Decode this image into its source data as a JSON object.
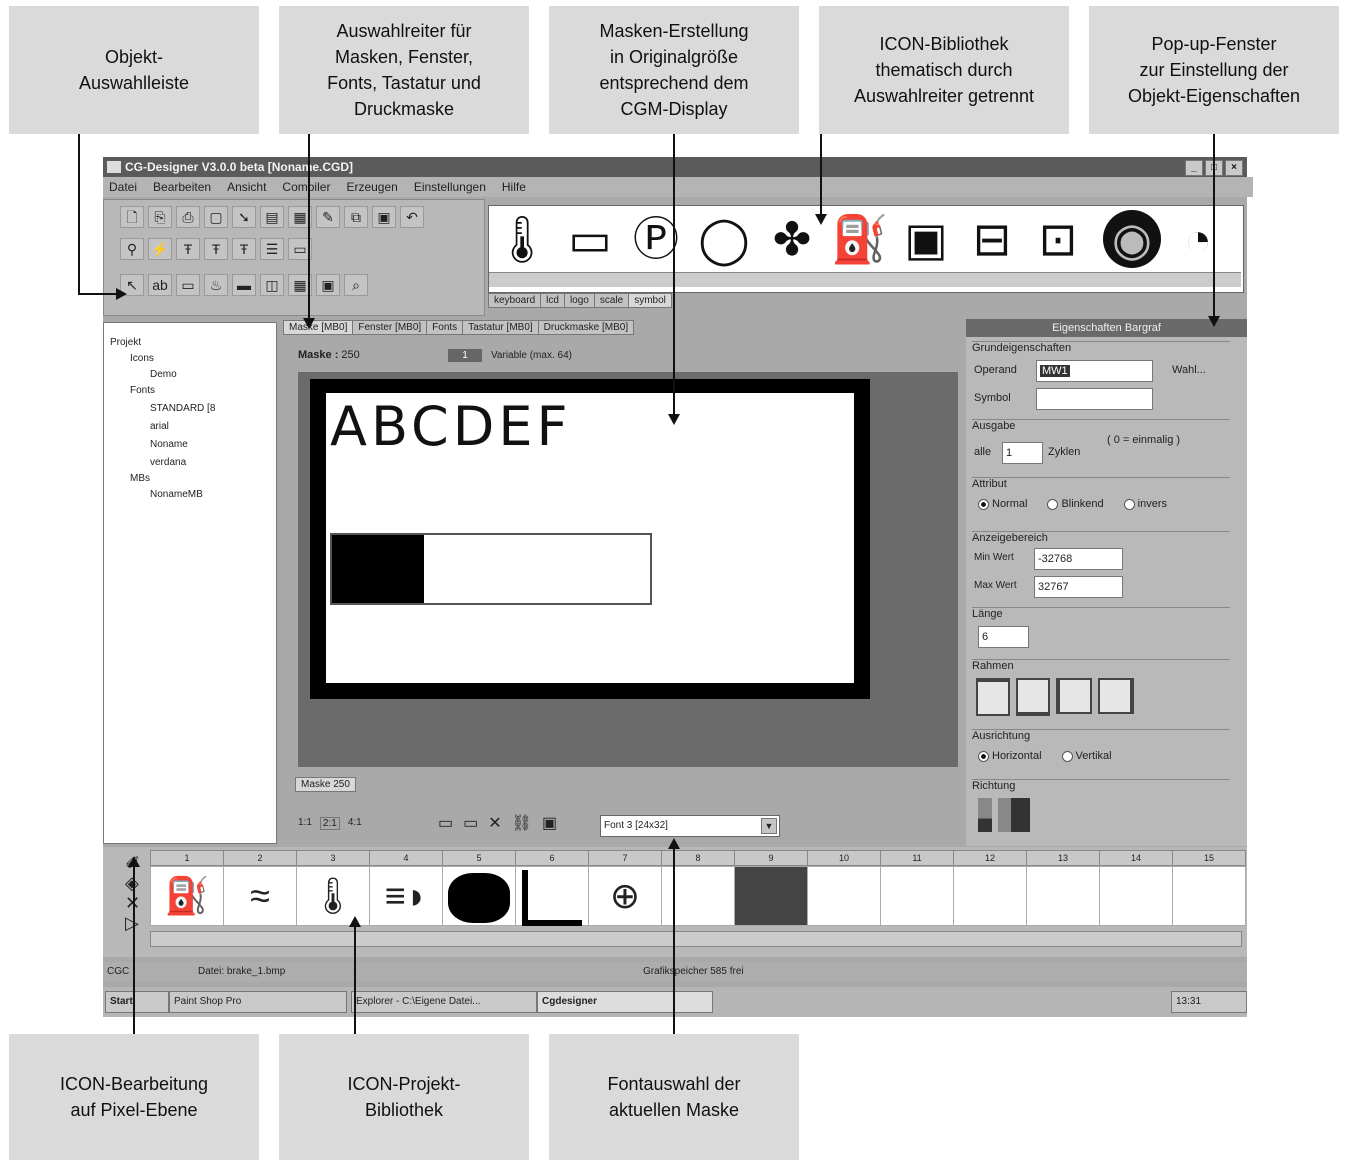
{
  "callouts": {
    "top": [
      "Objekt-\nAuswahlleiste",
      "Auswahlreiter für\nMasken, Fenster,\nFonts, Tastatur und\nDruckmaske",
      "Masken-Erstellung\nin Originalgröße\nentsprechend dem\nCGM-Display",
      "ICON-Bibliothek\nthematisch durch\nAuswahlreiter getrennt",
      "Pop-up-Fenster\nzur Einstellung der\nObjekt-Eigenschaften"
    ],
    "bottom": [
      "ICON-Bearbeitung\nauf Pixel-Ebene",
      "ICON-Projekt-\nBibliothek",
      "Fontauswahl der\naktuellen Maske"
    ]
  },
  "window": {
    "title": "CG-Designer V3.0.0 beta [Noname.CGD]",
    "menu": [
      "Datei",
      "Bearbeiten",
      "Ansicht",
      "Compiler",
      "Erzeugen",
      "Einstellungen",
      "Hilfe"
    ],
    "icon_tabs": [
      "keyboard",
      "lcd",
      "logo",
      "scale",
      "symbol"
    ],
    "main_tabs": [
      "Maske [MB0]",
      "Fenster [MB0]",
      "Fonts",
      "Tastatur [MB0]",
      "Druckmaske [MB0]"
    ],
    "mask_label": "Maske :",
    "mask_number": "250",
    "variable_count": "1",
    "variable_label": "Variable (max. 64)",
    "mask_text": "ABCDEF",
    "bar_fill_fraction": 0.29,
    "mask_tab": "Maske 250",
    "zoom_options": [
      "1:1",
      "2:1",
      "4:1"
    ],
    "font_select": "Font 3 [24x32]",
    "tree": [
      "Projekt",
      "Icons",
      "Demo",
      "Fonts",
      "STANDARD [8",
      "arial",
      "Noname",
      "verdana",
      "MBs",
      "NonameMB"
    ],
    "props": {
      "title": "Eigenschaften Bargraf",
      "grundeigenschaften": "Grundeigenschaften",
      "operand_label": "Operand",
      "operand_value": "MW1",
      "wahl": "Wahl...",
      "symbol_label": "Symbol",
      "ausgabe": "Ausgabe",
      "alle": "alle",
      "zyklen_value": "1",
      "zyklen": "Zyklen",
      "einmalig": "( 0 = einmalig )",
      "attribut": "Attribut",
      "attr_options": [
        "Normal",
        "Blinkend",
        "invers"
      ],
      "anzeigebereich": "Anzeigebereich",
      "min_label": "Min Wert",
      "min_value": "-32768",
      "max_label": "Max Wert",
      "max_value": "32767",
      "laenge": "Länge",
      "laenge_value": "6",
      "rahmen": "Rahmen",
      "ausrichtung": "Ausrichtung",
      "ausr_options": [
        "Horizontal",
        "Vertikal"
      ],
      "richtung": "Richtung"
    },
    "lib_columns": [
      "1",
      "2",
      "3",
      "4",
      "5",
      "6",
      "7",
      "8",
      "9",
      "10",
      "11",
      "12",
      "13",
      "14",
      "15"
    ],
    "status": {
      "left": "CGC",
      "file": "Datei: brake_1.bmp",
      "memory": "Grafikspeicher 585 frei"
    },
    "taskbar": {
      "start": "Start",
      "t1": "Paint Shop Pro",
      "t2": "Explorer - C:\\Eigene Datei...",
      "t3": "Cgdesigner",
      "clock": "13:31"
    }
  }
}
